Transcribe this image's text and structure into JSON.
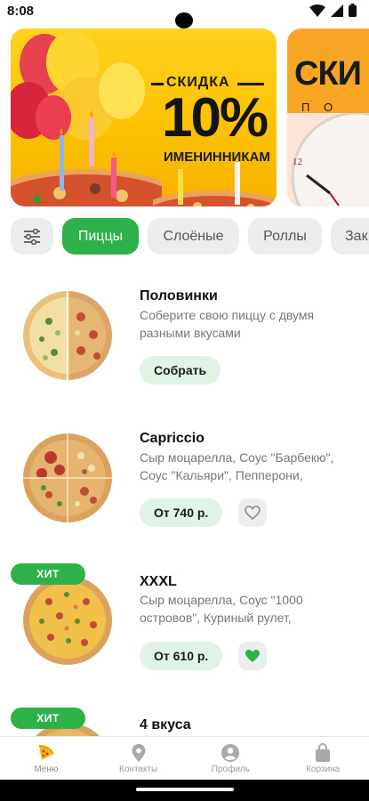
{
  "status_bar": {
    "time": "8:08"
  },
  "banners": [
    {
      "label_top": "СКИДКА",
      "big_text": "10%",
      "label_bottom": "ИМЕНИННИКАМ"
    },
    {
      "big_text": "СКИ",
      "label_bottom": "П О"
    }
  ],
  "categories": {
    "items": [
      "Пиццы",
      "Слоёные",
      "Роллы",
      "Зак"
    ],
    "active": "Пиццы"
  },
  "products": [
    {
      "title": "Половинки",
      "description": "Соберите свою пиццу с двумя разными вкусами",
      "button": "Собрать",
      "badge": ""
    },
    {
      "title": "Capriccio",
      "description": "Сыр моцарелла, Соус \"Барбекю\", Соус \"Кальяри\", Пепперони,",
      "button": "От 740 р.",
      "badge": "",
      "favorite": false
    },
    {
      "title": "XXXL",
      "description": "Сыр моцарелла, Соус \"1000 островов\", Куриный рулет,",
      "button": "От 610 р.",
      "badge": "ХИТ",
      "favorite": true
    },
    {
      "title": "4 вкуса",
      "badge": "ХИТ"
    }
  ],
  "bottom_nav": {
    "items": [
      {
        "label": "Меню",
        "icon": "pizza-slice-icon",
        "active": true
      },
      {
        "label": "Контакты",
        "icon": "location-pin-icon"
      },
      {
        "label": "Профиль",
        "icon": "user-icon"
      },
      {
        "label": "Корзина",
        "icon": "shopping-bag-icon"
      }
    ]
  },
  "colors": {
    "accent": "#2db24a",
    "accent_light": "#e0f3e4",
    "chip_bg": "#eceeee",
    "nav_active_icon": "#f2b617"
  }
}
